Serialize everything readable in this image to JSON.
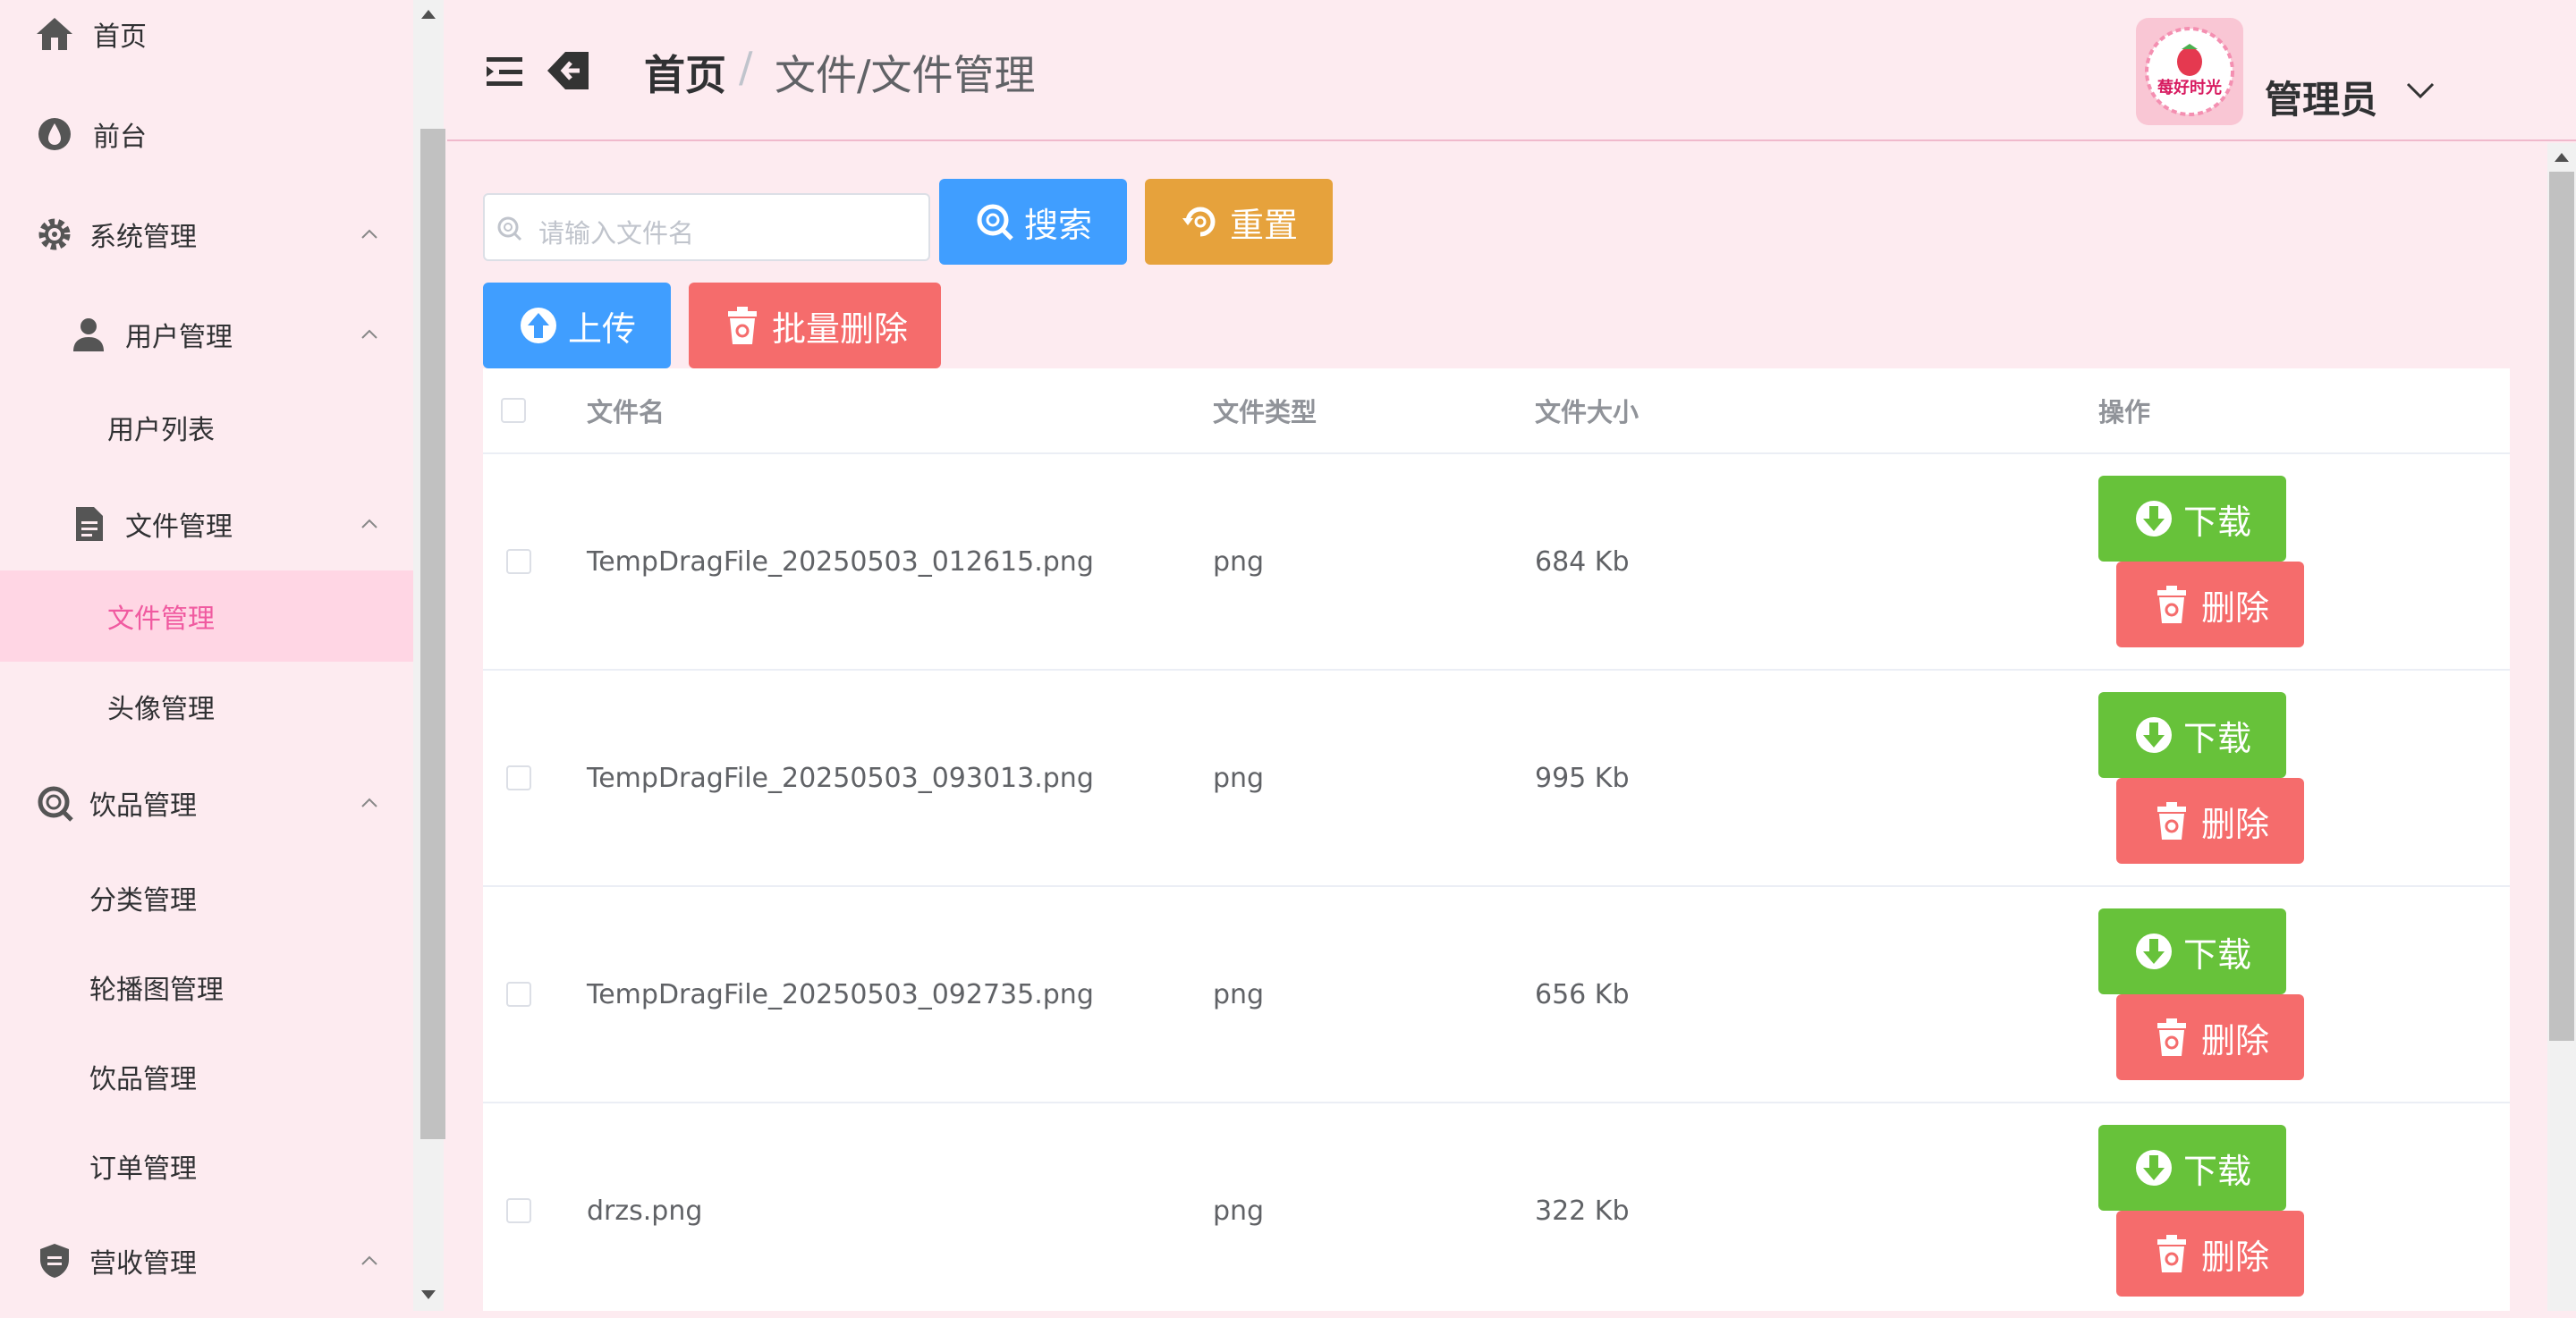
{
  "sidebar": {
    "items": [
      {
        "label": "首页",
        "icon": "home-icon"
      },
      {
        "label": "前台",
        "icon": "drop-icon"
      },
      {
        "label": "系统管理",
        "icon": "gear-icon"
      },
      {
        "label": "用户管理",
        "icon": "user-icon"
      },
      {
        "label": "用户列表"
      },
      {
        "label": "文件管理",
        "icon": "document-icon"
      },
      {
        "label": "文件管理"
      },
      {
        "label": "头像管理"
      },
      {
        "label": "饮品管理",
        "icon": "search-icon"
      },
      {
        "label": "分类管理"
      },
      {
        "label": "轮播图管理"
      },
      {
        "label": "饮品管理"
      },
      {
        "label": "订单管理"
      },
      {
        "label": "营收管理",
        "icon": "shield-icon"
      }
    ]
  },
  "header": {
    "breadcrumb_home": "首页",
    "breadcrumb_sep": "/",
    "breadcrumb_current": "文件/文件管理",
    "user_name": "管理员",
    "logo_text": "莓好时光"
  },
  "toolbar": {
    "search_placeholder": "请输入文件名",
    "search_label": "搜索",
    "reset_label": "重置",
    "upload_label": "上传",
    "batch_delete_label": "批量删除"
  },
  "table": {
    "columns": [
      "文件名",
      "文件类型",
      "文件大小",
      "操作"
    ],
    "rows": [
      {
        "name": "TempDragFile_20250503_012615.png",
        "type": "png",
        "size": "684 Kb"
      },
      {
        "name": "TempDragFile_20250503_093013.png",
        "type": "png",
        "size": "995 Kb"
      },
      {
        "name": "TempDragFile_20250503_092735.png",
        "type": "png",
        "size": "656 Kb"
      },
      {
        "name": "drzs.png",
        "type": "png",
        "size": "322 Kb"
      }
    ],
    "download_label": "下载",
    "delete_label": "删除"
  },
  "colors": {
    "primary": "#409eff",
    "warning": "#e6a23c",
    "danger": "#f56c6c",
    "success": "#67c23a",
    "active_menu": "#f05aa0",
    "background": "#fdebf0"
  }
}
